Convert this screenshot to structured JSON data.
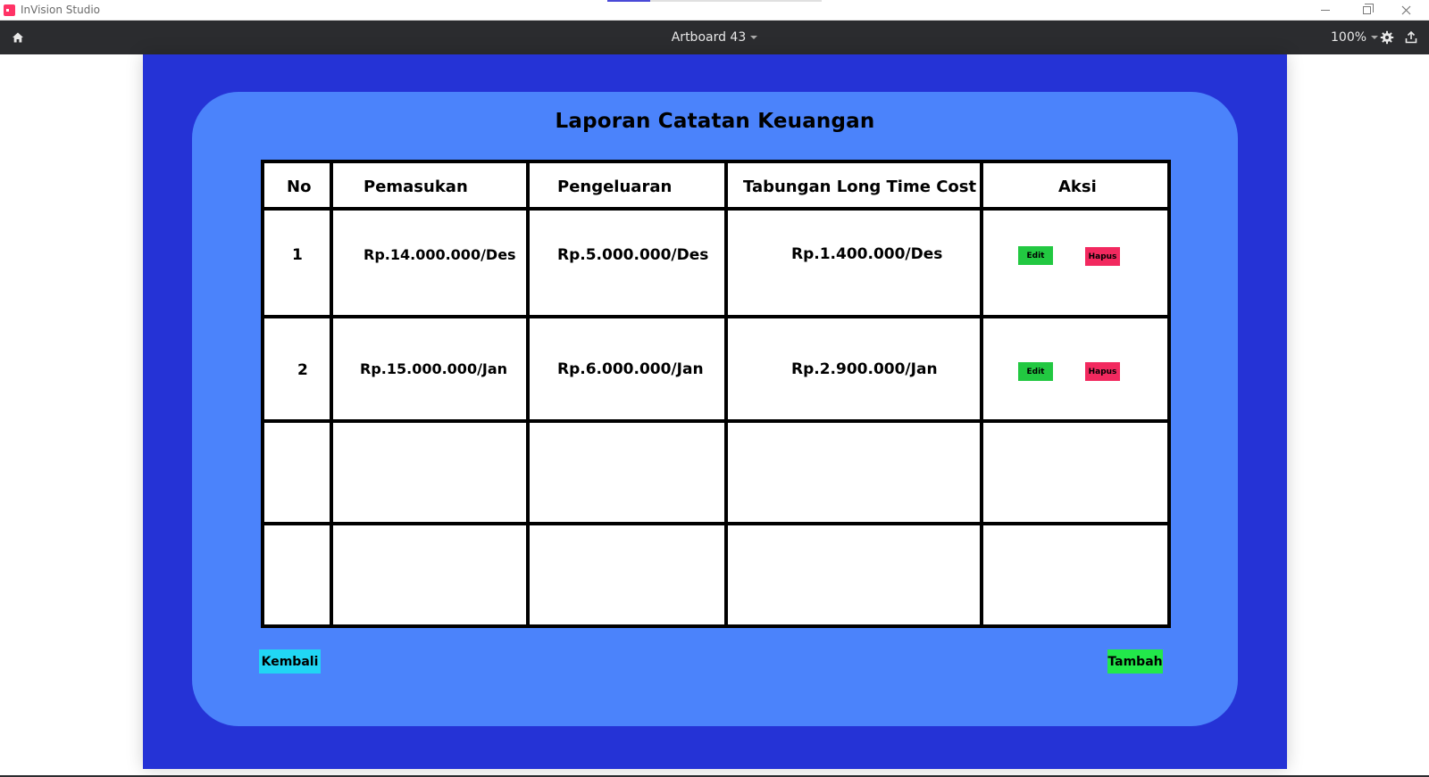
{
  "window": {
    "app_title": "InVision Studio"
  },
  "toolbar": {
    "artboard_label": "Artboard 43",
    "zoom_label": "100%",
    "icons": [
      "home-icon",
      "chevron-down-icon",
      "gear-icon",
      "export-icon"
    ]
  },
  "page": {
    "title": "Laporan Catatan Keuangan",
    "table": {
      "headers": [
        "No",
        "Pemasukan",
        "Pengeluaran",
        "Tabungan Long Time Cost",
        "Aksi"
      ],
      "rows": [
        {
          "no": "1",
          "pemasukan": "Rp.14.000.000/Des",
          "pengeluaran": "Rp.5.000.000/Des",
          "tabungan": "Rp.1.400.000/Des",
          "edit_label": "Edit",
          "hapus_label": "Hapus"
        },
        {
          "no": "2",
          "pemasukan": "Rp.15.000.000/Jan",
          "pengeluaran": "Rp.6.000.000/Jan",
          "tabungan": "Rp.2.900.000/Jan",
          "edit_label": "Edit",
          "hapus_label": "Hapus"
        }
      ]
    },
    "back_label": "Kembali",
    "add_label": "Tambah"
  },
  "colors": {
    "artboard_bg": "#2533d6",
    "panel_bg": "#4b83fb",
    "edit_button": "#22c841",
    "hapus_button": "#f2295f",
    "kembali_button": "#21d6f4",
    "tambah_button": "#22e84a",
    "toolbar_bg": "#2b2c2f"
  }
}
